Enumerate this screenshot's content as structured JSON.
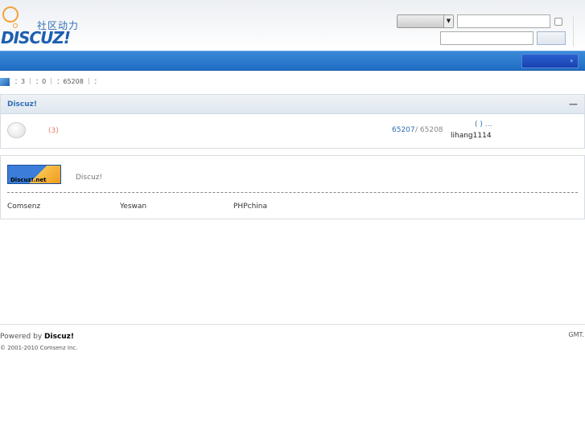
{
  "header": {
    "logo_cn": "社区动力",
    "logo_en": "DISCUZ!"
  },
  "nav": {
    "dropdown_arrow": "▾"
  },
  "stats": {
    "text": "：3 ｜ ：0 ｜ ：65208 ｜ ："
  },
  "category": {
    "title": "Discuz!",
    "collapse": "—"
  },
  "forum": {
    "count": "(3)",
    "threads": "65207",
    "posts": "/ 65208",
    "last_post": "( ) ...",
    "last_user": "lihang1114"
  },
  "links": {
    "logo_text": "Discuz!.net",
    "desc": "Discuz!",
    "items": [
      "Comsenz",
      "Yeswan",
      "PHPchina"
    ]
  },
  "footer": {
    "powered": "Powered by ",
    "brand": "Discuz!",
    "copyright": "© 2001-2010 Comsenz Inc.",
    "tz": "GMT."
  }
}
